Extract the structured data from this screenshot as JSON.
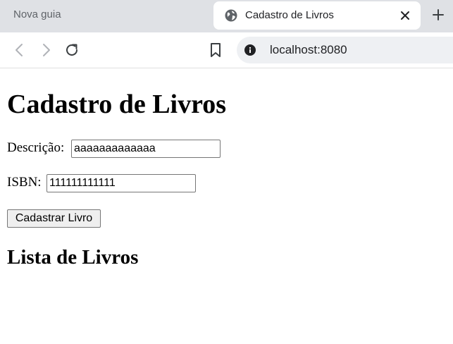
{
  "browser": {
    "tabs": [
      {
        "label": "Nova guia",
        "active": false
      },
      {
        "label": "Cadastro de Livros",
        "active": true
      }
    ],
    "url": "localhost:8080",
    "icons": {
      "globe": "globe-icon",
      "close": "close-icon",
      "new_tab": "plus-icon",
      "back": "arrow-left-icon",
      "forward": "arrow-right-icon",
      "reload": "reload-icon",
      "bookmark": "bookmark-icon",
      "site_info": "info-icon"
    }
  },
  "page": {
    "title": "Cadastro de Livros",
    "form": {
      "descricao_label": "Descrição:",
      "descricao_value": "aaaaaaaaaaaaa",
      "isbn_label": "ISBN:",
      "isbn_value": "111111111111",
      "submit_label": "Cadastrar Livro"
    },
    "list_heading": "Lista de Livros"
  }
}
